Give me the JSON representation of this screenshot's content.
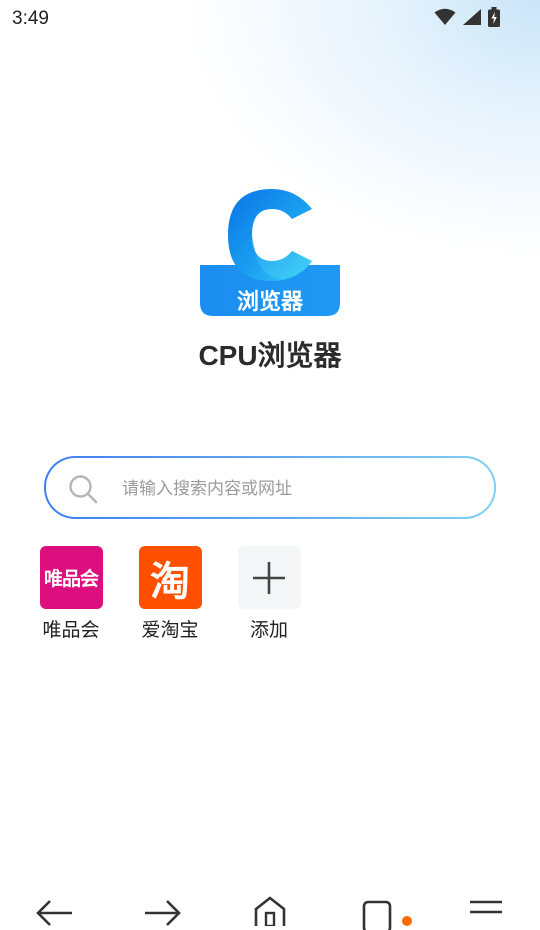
{
  "status_bar": {
    "time": "3:49"
  },
  "logo": {
    "badge_text": "浏览器"
  },
  "app": {
    "title": "CPU浏览器"
  },
  "search": {
    "placeholder": "请输入搜索内容或网址",
    "value": ""
  },
  "shortcuts": [
    {
      "label": "唯品会",
      "tile_text": "唯品会",
      "color": "#dd0e7e"
    },
    {
      "label": "爱淘宝",
      "tile_text": "淘",
      "color": "#ff5000"
    },
    {
      "label": "添加",
      "icon": "plus-icon"
    }
  ],
  "bottom_nav": {
    "items": [
      {
        "icon": "back-arrow-icon"
      },
      {
        "icon": "forward-arrow-icon"
      },
      {
        "icon": "home-icon"
      },
      {
        "icon": "tabs-icon"
      },
      {
        "icon": "menu-icon"
      }
    ]
  },
  "colors": {
    "accent_blue": "#1e90f0",
    "search_border_start": "#3d7ff2",
    "search_border_end": "#7fd0f0"
  }
}
